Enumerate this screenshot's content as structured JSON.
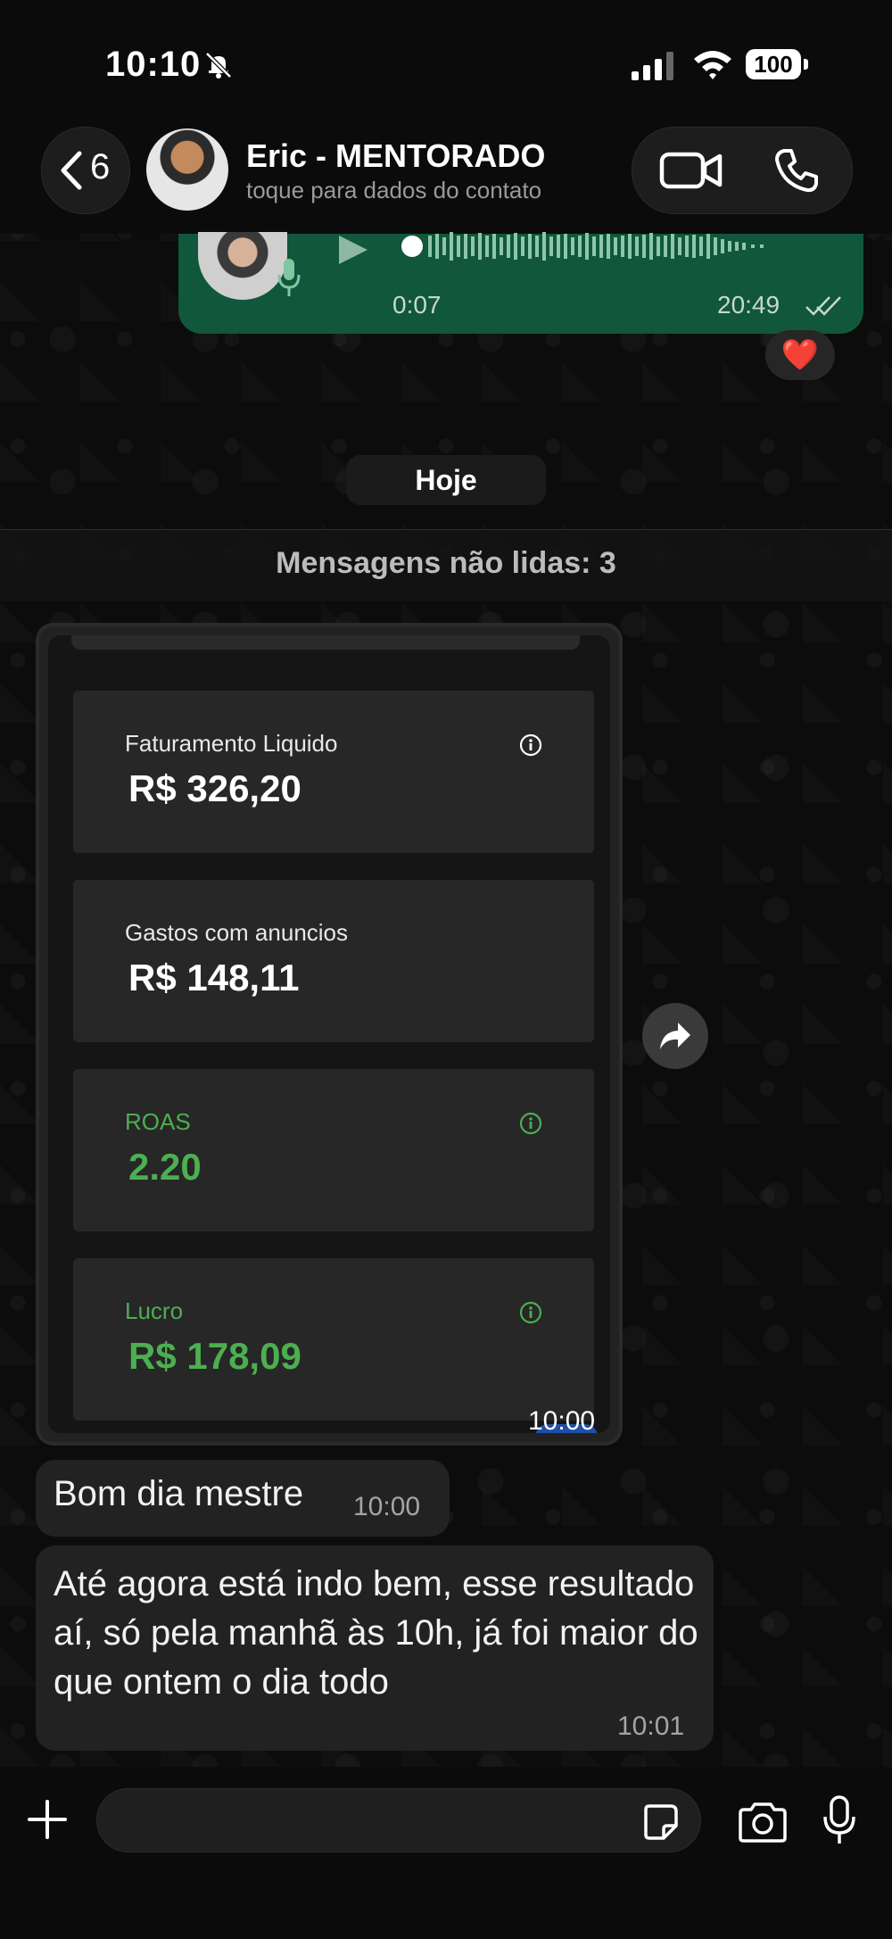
{
  "status_bar": {
    "time": "10:10",
    "battery": "100"
  },
  "header": {
    "back_count": "6",
    "contact_name": "Eric - MENTORADO",
    "contact_subtitle": "toque para dados do contato"
  },
  "voice_message": {
    "duration": "0:07",
    "time": "20:49",
    "reaction": "❤️"
  },
  "date_label": "Hoje",
  "unread_label": "Mensagens não lidas: 3",
  "image_message": {
    "time": "10:00",
    "metrics": [
      {
        "label": "Faturamento Liquido",
        "value": "R$ 326,20"
      },
      {
        "label": "Gastos com anuncios",
        "value": "R$ 148,11"
      },
      {
        "label": "ROAS",
        "value": "2.20"
      },
      {
        "label": "Lucro",
        "value": "R$ 178,09"
      }
    ]
  },
  "messages": [
    {
      "text": "Bom dia mestre",
      "time": "10:00"
    },
    {
      "text": "Até agora está indo bem, esse resultado aí, só pela manhã às 10h, já foi maior do que ontem o dia todo",
      "time": "10:01"
    }
  ],
  "input": {
    "placeholder": ""
  },
  "colors": {
    "accent_green": "#4caf50",
    "bubble_out": "#10573b",
    "bubble_in": "#222222"
  }
}
